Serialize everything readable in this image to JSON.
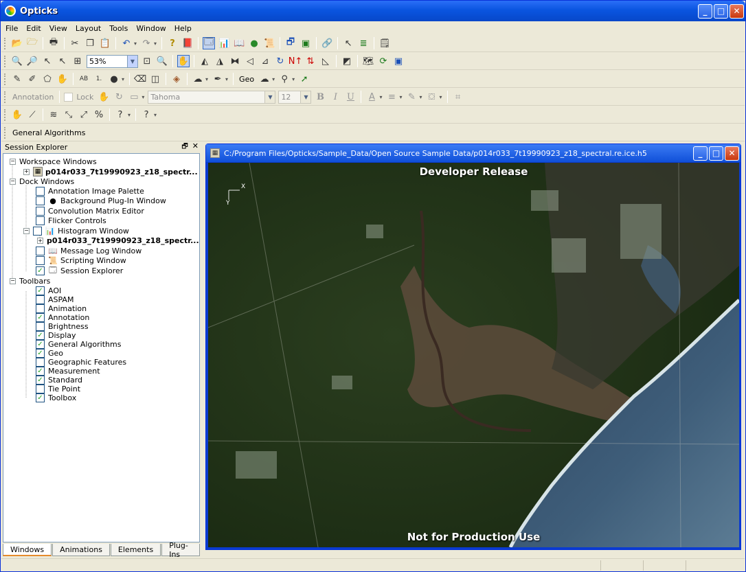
{
  "window": {
    "title": "Opticks"
  },
  "menu": [
    "File",
    "Edit",
    "View",
    "Layout",
    "Tools",
    "Window",
    "Help"
  ],
  "toolbar2": {
    "zoom": "53%"
  },
  "toolbar3": {
    "geo_label": "Geo"
  },
  "toolbar4": {
    "annotation_label": "Annotation",
    "lock_label": "Lock",
    "font": "Tahoma",
    "font_size": "12",
    "bold": "B",
    "italic": "I",
    "underline": "U"
  },
  "toolbar6": {
    "general_algorithms": "General Algorithms"
  },
  "session_explorer": {
    "title": "Session Explorer",
    "workspace_windows": "Workspace Windows",
    "workspace_item": "p014r033_7t19990923_z18_spectr...",
    "dock_windows": "Dock Windows",
    "dock_items": [
      {
        "label": "Annotation Image Palette",
        "checked": false
      },
      {
        "label": "Background Plug-In Window",
        "checked": false
      },
      {
        "label": "Convolution Matrix Editor",
        "checked": false
      },
      {
        "label": "Flicker Controls",
        "checked": false
      },
      {
        "label": "Histogram Window",
        "checked": false
      },
      {
        "label": "p014r033_7t19990923_z18_spectr...",
        "checked": false
      },
      {
        "label": "Message Log Window",
        "checked": false
      },
      {
        "label": "Scripting Window",
        "checked": false
      },
      {
        "label": "Session Explorer",
        "checked": true
      }
    ],
    "toolbars": "Toolbars",
    "toolbar_items": [
      {
        "label": "AOI",
        "checked": true
      },
      {
        "label": "ASPAM",
        "checked": false
      },
      {
        "label": "Animation",
        "checked": false
      },
      {
        "label": "Annotation",
        "checked": true
      },
      {
        "label": "Brightness",
        "checked": false
      },
      {
        "label": "Display",
        "checked": true
      },
      {
        "label": "General Algorithms",
        "checked": true
      },
      {
        "label": "Geo",
        "checked": true
      },
      {
        "label": "Geographic Features",
        "checked": false
      },
      {
        "label": "Measurement",
        "checked": true
      },
      {
        "label": "Standard",
        "checked": true
      },
      {
        "label": "Tie Point",
        "checked": false
      },
      {
        "label": "Toolbox",
        "checked": true
      }
    ],
    "tabs": [
      "Windows",
      "Animations",
      "Elements",
      "Plug-Ins"
    ]
  },
  "document": {
    "title": "C:/Program Files/Opticks/Sample_Data/Open Source Sample Data/p014r033_7t19990923_z18_spectral.re.ice.h5",
    "watermark_top": "Developer Release",
    "watermark_bottom": "Not for Production Use",
    "axis_x": "X",
    "axis_y": "Y"
  }
}
